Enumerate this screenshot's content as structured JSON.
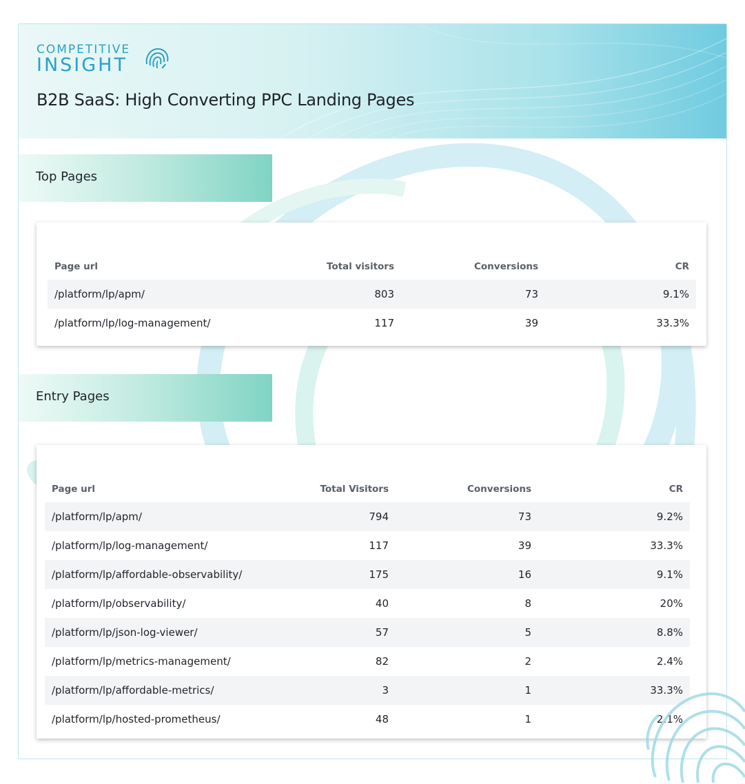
{
  "logo": {
    "line1": "COMPETITIVE",
    "line2": "INSIGHT"
  },
  "report_title": "B2B SaaS: High Converting PPC Landing Pages",
  "top_pages": {
    "heading": "Top Pages",
    "columns": [
      "Page url",
      "Total visitors",
      "Conversions",
      "CR"
    ],
    "rows": [
      [
        "/platform/lp/apm/",
        "803",
        "73",
        "9.1%"
      ],
      [
        "/platform/lp/log-management/",
        "117",
        "39",
        "33.3%"
      ]
    ]
  },
  "entry_pages": {
    "heading": "Entry Pages",
    "columns": [
      "Page url",
      "Total Visitors",
      "Conversions",
      "CR"
    ],
    "rows": [
      [
        "/platform/lp/apm/",
        "794",
        "73",
        "9.2%"
      ],
      [
        "/platform/lp/log-management/",
        "117",
        "39",
        "33.3%"
      ],
      [
        "/platform/lp/affordable-observability/",
        "175",
        "16",
        "9.1%"
      ],
      [
        "/platform/lp/observability/",
        "40",
        "8",
        "20%"
      ],
      [
        "/platform/lp/json-log-viewer/",
        "57",
        "5",
        "8.8%"
      ],
      [
        "/platform/lp/metrics-management/",
        "82",
        "2",
        "2.4%"
      ],
      [
        "/platform/lp/affordable-metrics/",
        "3",
        "1",
        "33.3%"
      ],
      [
        "/platform/lp/hosted-prometheus/",
        "48",
        "1",
        "2.1%"
      ]
    ]
  },
  "colors": {
    "brand": "#2aa0c8",
    "header_gradient_end": "#6fcbe0",
    "banner_accent": "#7fd4c4",
    "row_shade": "#f3f4f6"
  }
}
